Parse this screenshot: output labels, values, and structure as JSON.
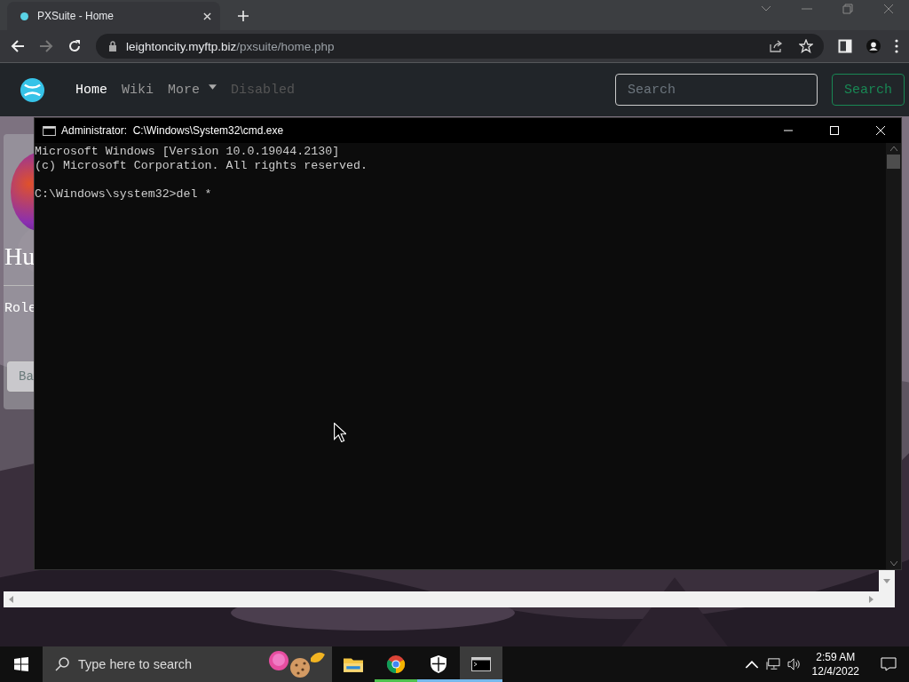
{
  "browser": {
    "tab": {
      "title": "PXSuite - Home"
    },
    "address": {
      "host": "leightoncity.myftp.biz",
      "path": "/pxsuite/home.php"
    }
  },
  "navbar": {
    "items": [
      {
        "label": "Home",
        "selected": true,
        "disabled": false,
        "dropdown": false
      },
      {
        "label": "Wiki",
        "selected": false,
        "disabled": false,
        "dropdown": false
      },
      {
        "label": "More",
        "selected": false,
        "disabled": false,
        "dropdown": true
      },
      {
        "label": "Disabled",
        "selected": false,
        "disabled": true,
        "dropdown": false
      }
    ],
    "search": {
      "placeholder": "Search"
    },
    "search_button": "Search"
  },
  "page": {
    "heading": "Hu",
    "label": "Role",
    "button": "Ba"
  },
  "console": {
    "title": "Administrator:  C:\\Windows\\System32\\cmd.exe",
    "output": [
      "Microsoft Windows [Version 10.0.19044.2130]",
      "(c) Microsoft Corporation. All rights reserved."
    ],
    "prompt": "C:\\Windows\\system32>del *"
  },
  "taskbar": {
    "search": {
      "placeholder": "Type here to search"
    },
    "apps": [
      {
        "kind": "folder",
        "running": false,
        "selected": false
      },
      {
        "kind": "browser",
        "running": true,
        "selected": false,
        "color": "#4ec24e"
      },
      {
        "kind": "shield",
        "running": true,
        "selected": false,
        "color": "#76b9ed"
      },
      {
        "kind": "terminal",
        "running": true,
        "selected": true,
        "color": "#76b9ed"
      }
    ],
    "time": "2:59 AM",
    "date": "12/4/2022"
  }
}
